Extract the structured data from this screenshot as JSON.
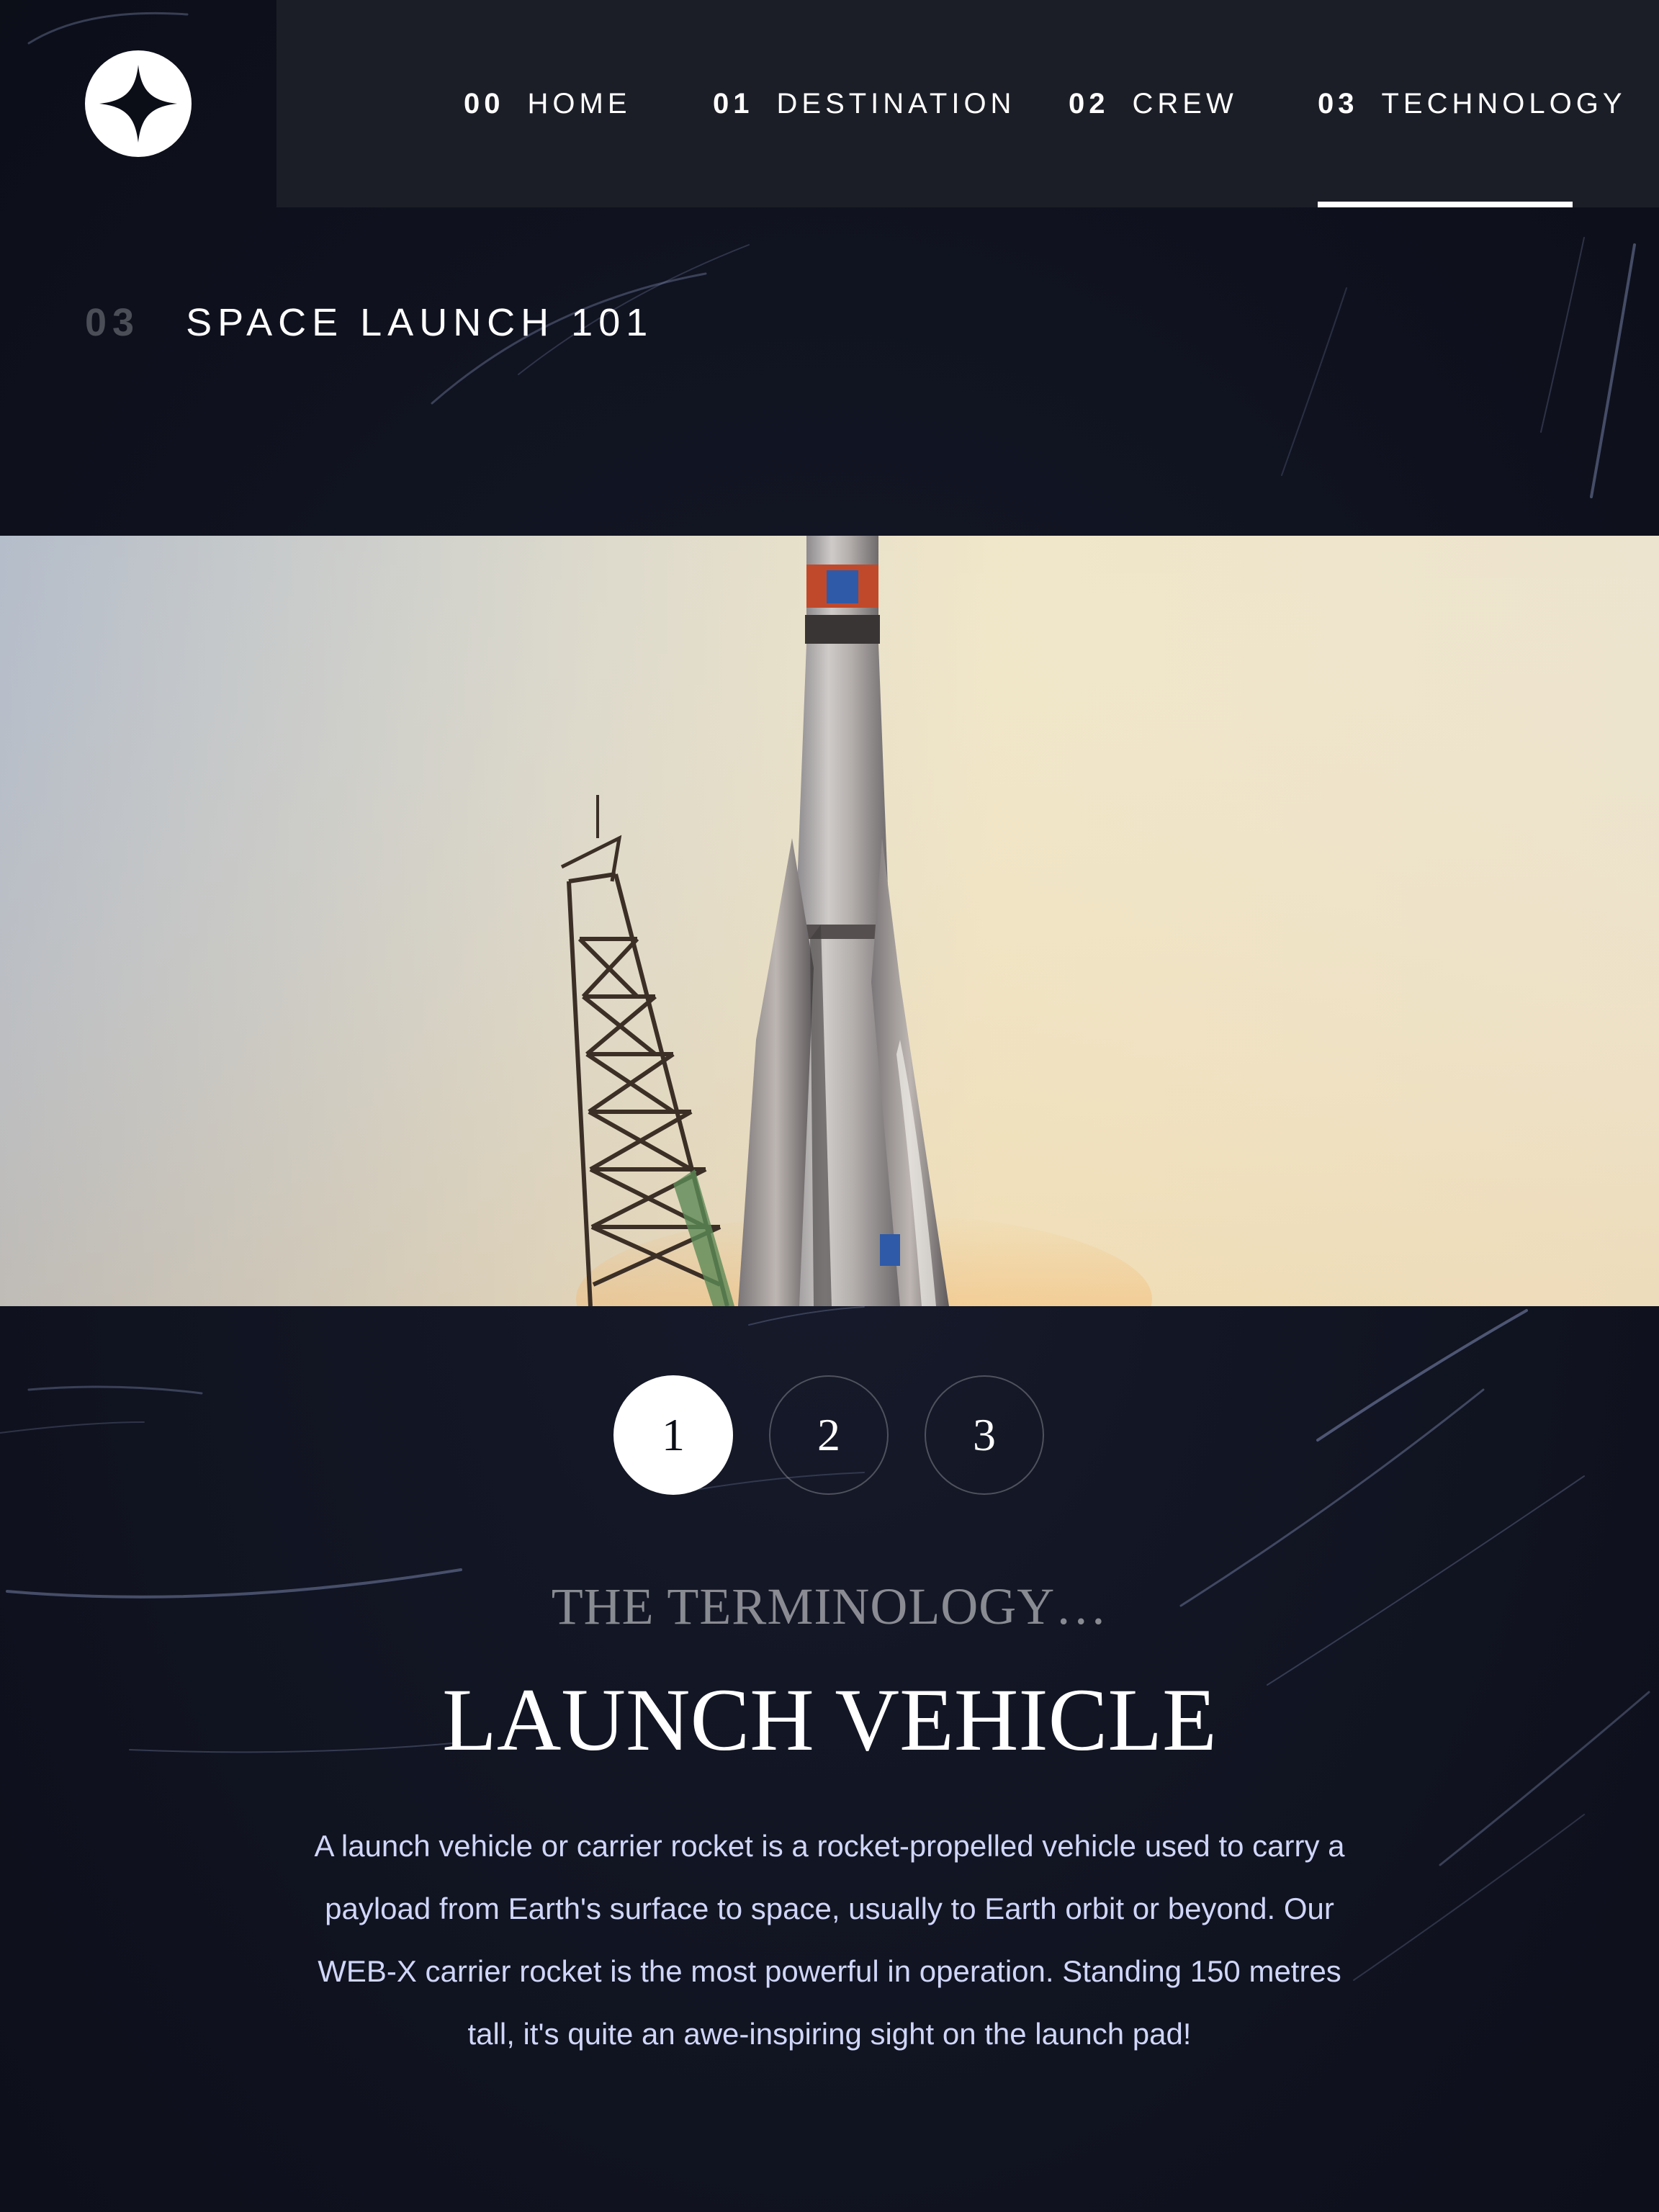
{
  "logo": {
    "icon": "four-point-star-icon"
  },
  "nav": {
    "items": [
      {
        "num": "00",
        "label": "HOME",
        "active": false
      },
      {
        "num": "01",
        "label": "DESTINATION",
        "active": false
      },
      {
        "num": "02",
        "label": "CREW",
        "active": false
      },
      {
        "num": "03",
        "label": "TECHNOLOGY",
        "active": true
      }
    ]
  },
  "page": {
    "heading_num": "03",
    "heading": "SPACE LAUNCH 101"
  },
  "hero": {
    "image": "rocket-launch-photo"
  },
  "pager": {
    "items": [
      "1",
      "2",
      "3"
    ],
    "active_index": 0
  },
  "tech": {
    "eyebrow": "THE TERMINOLOGY…",
    "title": "LAUNCH VEHICLE",
    "description": "A launch vehicle or carrier rocket is a rocket-propelled vehicle used to carry a payload from Earth's surface to space, usually to Earth orbit or beyond. Our WEB-X carrier rocket is the most powerful in operation. Standing 150 metres tall, it's quite an awe-inspiring sight on the launch pad!"
  },
  "colors": {
    "background": "#0b0d17",
    "nav_bg": "#1c1e27",
    "text_light": "#d0d6f9",
    "white": "#ffffff"
  }
}
